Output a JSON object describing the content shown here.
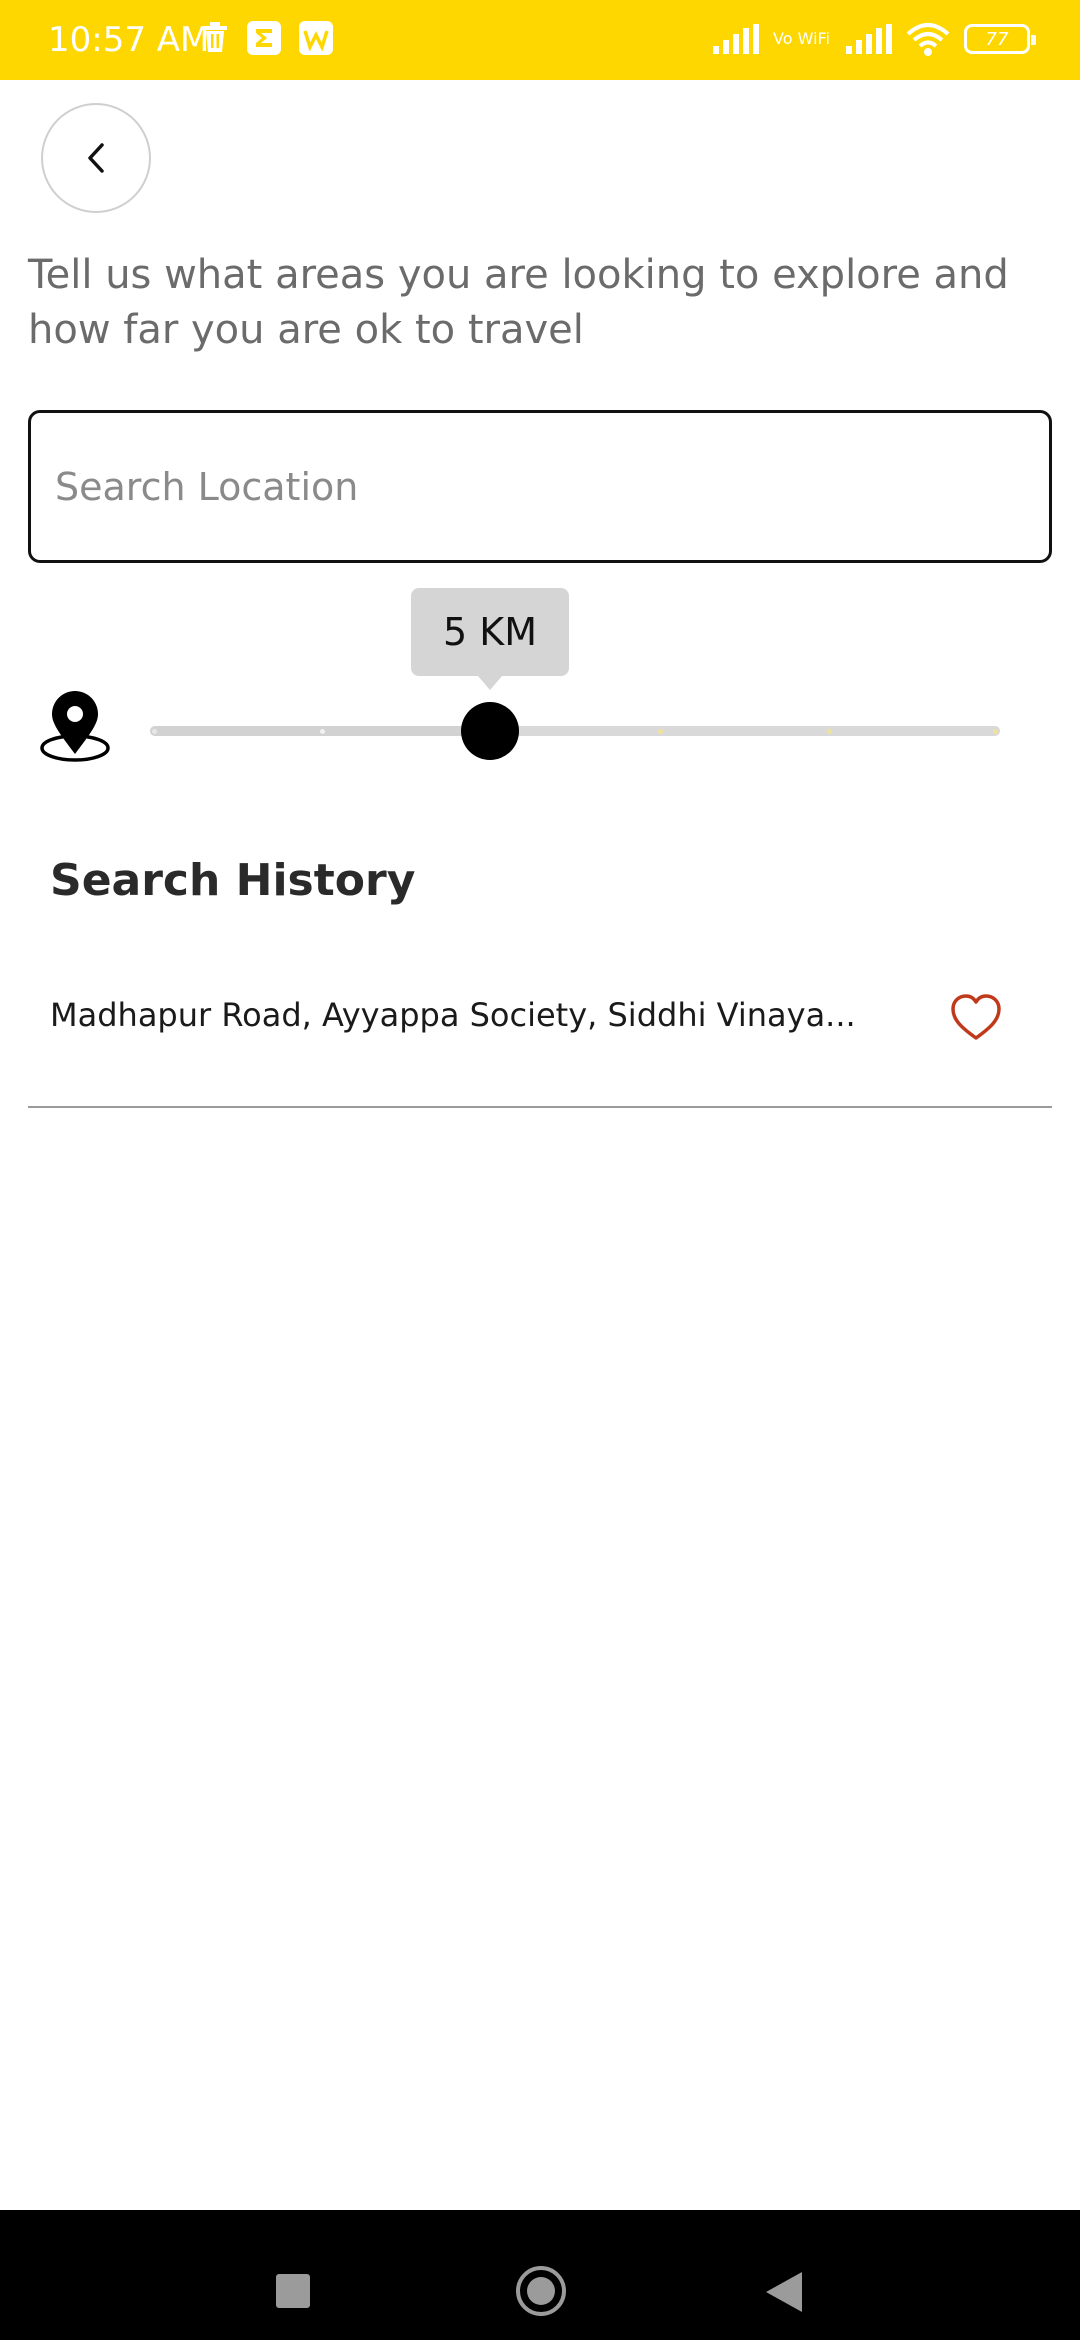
{
  "status_bar": {
    "time": "10:57 AM",
    "left_icons": [
      "trash-icon",
      "sigma-app-icon",
      "wps-office-icon"
    ],
    "network": "Vo WiFi",
    "battery": "77",
    "background": "#FFD700"
  },
  "header": {
    "back_icon": "chevron-left-icon",
    "intro": "Tell us what areas you are looking to explore and how far you are ok to travel"
  },
  "search": {
    "placeholder": "Search Location",
    "value": ""
  },
  "distance_slider": {
    "icon": "location-pin-icon",
    "label": "5 KM",
    "value_fraction": 0.4
  },
  "history": {
    "title": "Search History",
    "items": [
      {
        "text": "Madhapur Road, Ayyappa Society, Siddhi Vinaya...",
        "favorite_icon": "heart-outline-icon",
        "favorite_color": "#C0391B"
      }
    ]
  },
  "nav": {
    "recents_icon": "square-icon",
    "home_icon": "circle-icon",
    "back_icon": "triangle-back-icon"
  }
}
